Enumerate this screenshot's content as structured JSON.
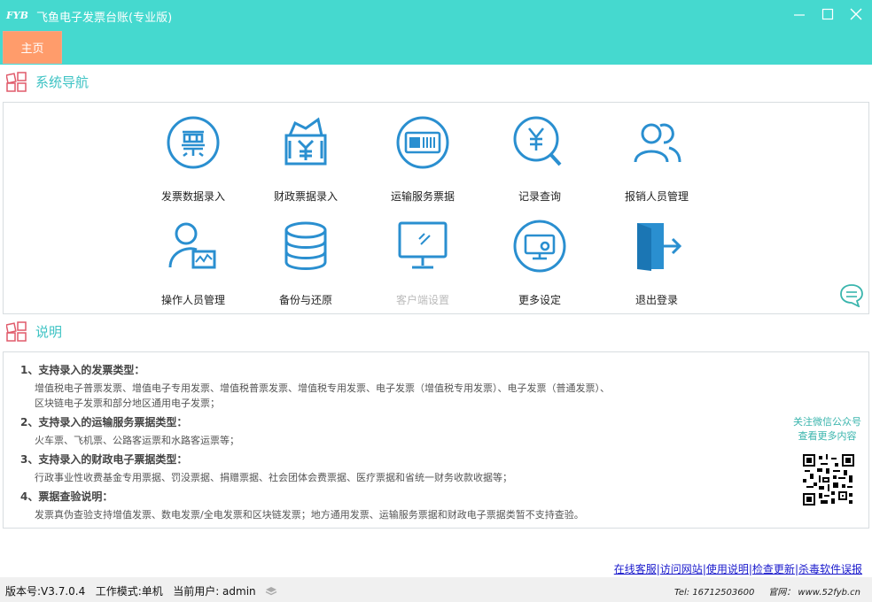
{
  "window": {
    "logo": "FYB",
    "title": "飞鱼电子发票台账(专业版)"
  },
  "tabs": [
    {
      "label": "主页",
      "active": true
    }
  ],
  "nav_section": {
    "title": "系统导航"
  },
  "nav_items": [
    {
      "label": "发票数据录入",
      "icon": "invoice-ticket-icon"
    },
    {
      "label": "财政票据录入",
      "icon": "finance-receipt-icon"
    },
    {
      "label": "运输服务票据",
      "icon": "transport-ticket-icon"
    },
    {
      "label": "记录查询",
      "icon": "yen-search-icon"
    },
    {
      "label": "报销人员管理",
      "icon": "users-icon"
    },
    {
      "label": "操作人员管理",
      "icon": "operator-icon"
    },
    {
      "label": "备份与还原",
      "icon": "database-icon"
    },
    {
      "label": "客户端设置",
      "icon": "monitor-icon"
    },
    {
      "label": "更多设定",
      "icon": "settings-screen-icon"
    },
    {
      "label": "退出登录",
      "icon": "logout-icon"
    }
  ],
  "desc_section": {
    "title": "说明"
  },
  "descriptions": [
    {
      "heading": "1、支持录入的发票类型：",
      "lines": [
        "增值税电子普票发票、增值电子专用发票、增值税普票发票、增值税专用发票、电子发票（增值税专用发票）、电子发票（普通发票）、",
        "区块链电子发票和部分地区通用电子发票；"
      ]
    },
    {
      "heading": "2、支持录入的运输服务票据类型：",
      "lines": [
        "火车票、飞机票、公路客运票和水路客运票等；"
      ]
    },
    {
      "heading": "3、支持录入的财政电子票据类型：",
      "lines": [
        "行政事业性收费基金专用票据、罚没票据、捐赠票据、社会团体会费票据、医疗票据和省统一财务收款收据等；"
      ]
    },
    {
      "heading": "4、票据查验说明：",
      "lines": [
        "发票真伪查验支持增值发票、数电发票/全电发票和区块链发票；地方通用发票、运输服务票据和财政电子票据类暂不支持查验。"
      ]
    }
  ],
  "wechat": {
    "line1": "关注微信公众号",
    "line2": "查看更多内容"
  },
  "links": [
    "在线客服",
    "访问网站",
    "使用说明",
    "检查更新",
    "杀毒软件误报"
  ],
  "status": {
    "version": "版本号:V3.7.0.4",
    "mode": "工作模式:单机",
    "user": "当前用户:  admin",
    "tel": "Tel: 16712503600",
    "site": "官网：  www.52fyb.cn"
  },
  "colors": {
    "accent": "#45d9cf",
    "tab": "#ff9c6b",
    "icon": "#2a8fd0",
    "section_title": "#3ec3c4"
  }
}
